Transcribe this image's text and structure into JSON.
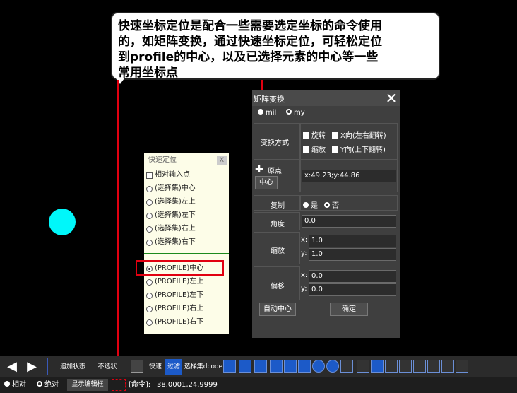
{
  "annotation": {
    "text": "快速坐标定位是配合一些需要选定坐标的命令使用\n的，如矩阵变换，通过快速坐标定位，可轻松定位\n到profile的中心，以及已选择元素的中心等一些\n常用坐标点"
  },
  "quick_panel": {
    "title": "快速定位",
    "close": "X",
    "relative_input": "相对输入点",
    "selection_items": [
      "(选择集)中心",
      "(选择集)左上",
      "(选择集)左下",
      "(选择集)右上",
      "(选择集)右下"
    ],
    "profile_items": [
      "(PROFILE)中心",
      "(PROFILE)左上",
      "(PROFILE)左下",
      "(PROFILE)右上",
      "(PROFILE)右下"
    ],
    "selected": "(PROFILE)中心"
  },
  "matrix_dialog": {
    "title": "矩阵变换",
    "unit_mil": "mil",
    "unit_my": "my",
    "transform_method_label": "变换方式",
    "rotate": "旋转",
    "flip_x": "X向(左右翻转)",
    "scale_chk": "缩放",
    "flip_y": "Y向(上下翻转)",
    "origin_label": "原点",
    "center_button": "中心",
    "origin_value": "x:49.23;y:44.86",
    "copy_label": "复制",
    "copy_yes": "是",
    "copy_no": "否",
    "angle_label": "角度",
    "angle_value": "0.0",
    "scale_label": "缩放",
    "scale_x_prefix": "x:",
    "scale_x": "1.0",
    "scale_y_prefix": "y:",
    "scale_y": "1.0",
    "offset_label": "偏移",
    "offset_x_prefix": "x:",
    "offset_x": "0.0",
    "offset_y_prefix": "y:",
    "offset_y": "0.0",
    "auto_center_button": "自动中心",
    "confirm_button": "确定"
  },
  "toolbar": {
    "add_state": "追加状态",
    "not_selected": "不选状",
    "fast": "快速",
    "filter": "过滤",
    "selection_dcode": "选择集dcode"
  },
  "statusbar": {
    "relative": "相对",
    "absolute": "绝对",
    "show_edit_box": "显示编辑框",
    "command_prompt": "[命令]:",
    "coordinates": "38.0001,24.9999"
  },
  "colors": {
    "accent_red": "#e10010",
    "cyan": "#00f7fa",
    "toolbar_blue": "#1c5ac8"
  }
}
